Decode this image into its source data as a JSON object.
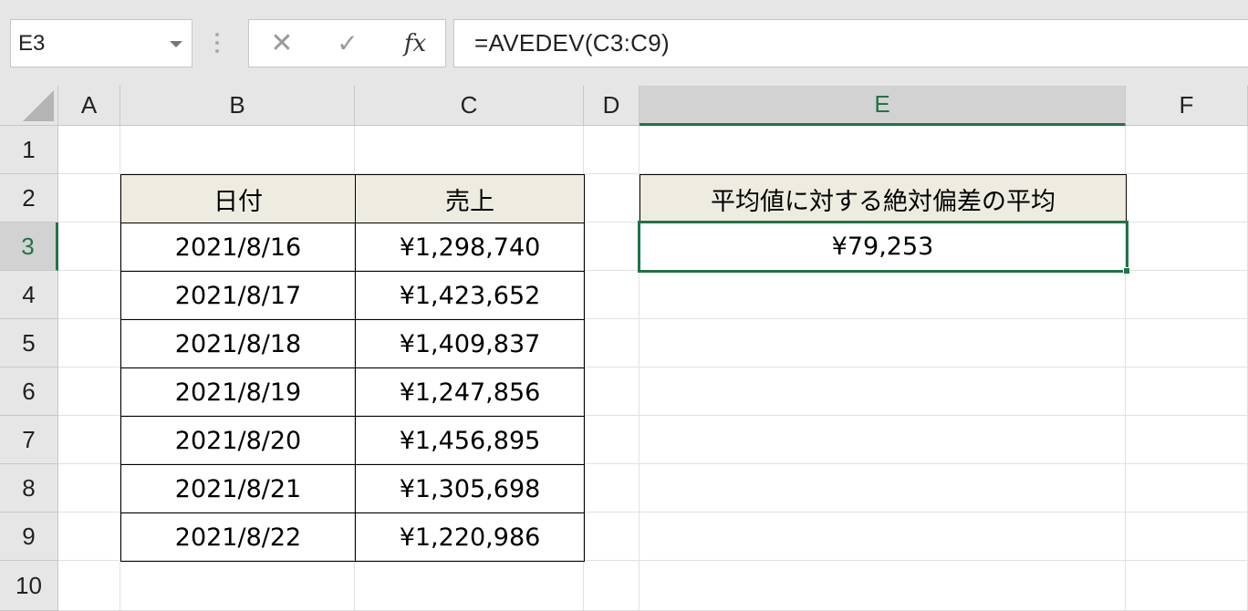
{
  "formula_bar": {
    "name_box": "E3",
    "cancel_icon": "✕",
    "enter_icon": "✓",
    "fx_label": "fx",
    "formula": "=AVEDEV(C3:C9)"
  },
  "columns": [
    "A",
    "B",
    "C",
    "D",
    "E",
    "F"
  ],
  "selected_column": "E",
  "rows": [
    "1",
    "2",
    "3",
    "4",
    "5",
    "6",
    "7",
    "8",
    "9",
    "10"
  ],
  "selected_row": "3",
  "sales_table": {
    "headers": {
      "date": "日付",
      "sales": "売上"
    },
    "rows": [
      {
        "date": "2021/8/16",
        "sales": "¥1,298,740"
      },
      {
        "date": "2021/8/17",
        "sales": "¥1,423,652"
      },
      {
        "date": "2021/8/18",
        "sales": "¥1,409,837"
      },
      {
        "date": "2021/8/19",
        "sales": "¥1,247,856"
      },
      {
        "date": "2021/8/20",
        "sales": "¥1,456,895"
      },
      {
        "date": "2021/8/21",
        "sales": "¥1,305,698"
      },
      {
        "date": "2021/8/22",
        "sales": "¥1,220,986"
      }
    ]
  },
  "result": {
    "label": "平均値に対する絶対偏差の平均",
    "value": "¥79,253"
  },
  "colors": {
    "accent": "#217346",
    "header_fill": "#eeece1"
  }
}
